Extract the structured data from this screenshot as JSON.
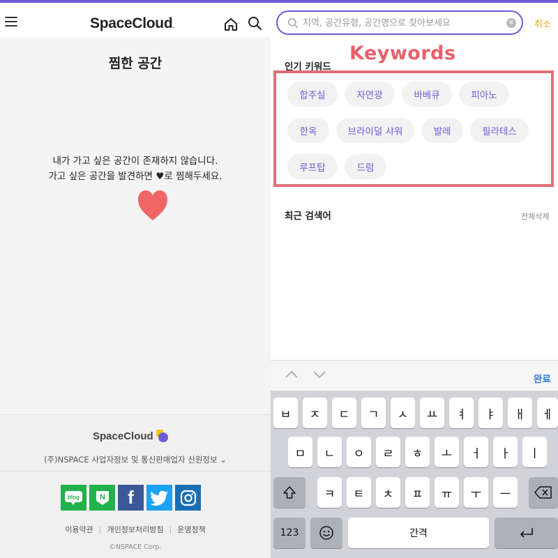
{
  "left": {
    "brand": "SpaceCloud",
    "title": "찜한 공간",
    "empty_line1": "내가 가고 싶은 공간이 존재하지 않습니다.",
    "empty_line2_before": "가고 싶은 공간을 발견하면 ",
    "empty_line2_heart": "♥",
    "empty_line2_after": "로 찜해두세요.",
    "footer": {
      "brand": "SpaceCloud",
      "company": "(주)NSPACE 사업자정보 및 통신판매업자 신원정보",
      "social": [
        {
          "name": "blog",
          "label": "blog",
          "color": "#21b24b"
        },
        {
          "name": "naver-post",
          "label": "N",
          "color": "#21b24b"
        },
        {
          "name": "facebook",
          "label": "f",
          "color": "#3b5998"
        },
        {
          "name": "twitter",
          "label": "",
          "color": "#1da1f2"
        },
        {
          "name": "instagram",
          "label": "",
          "color": "#1a6fb5"
        }
      ],
      "links": [
        "이용약관",
        "개인정보처리방침",
        "운영정책"
      ],
      "copyright": "©NSPACE Corp."
    }
  },
  "right": {
    "search": {
      "placeholder": "지역, 공간유형, 공간명으로 찾아보세요",
      "value": ""
    },
    "cancel": "취소",
    "annotation": "Keywords",
    "popular_title": "인기 키워드",
    "keywords": [
      "합주실",
      "자연광",
      "바베큐",
      "피아노",
      "한옥",
      "브라이덜 샤워",
      "발레",
      "필라테스",
      "루프탑",
      "드럼"
    ],
    "recent_title": "최근 검색어",
    "clear_all": "전체삭제",
    "keyboard": {
      "done": "완료",
      "row1": [
        "ㅂ",
        "ㅈ",
        "ㄷ",
        "ㄱ",
        "ㅅ",
        "ㅛ",
        "ㅕ",
        "ㅑ",
        "ㅐ",
        "ㅔ"
      ],
      "row2": [
        "ㅁ",
        "ㄴ",
        "ㅇ",
        "ㄹ",
        "ㅎ",
        "ㅗ",
        "ㅓ",
        "ㅏ",
        "ㅣ"
      ],
      "row3": [
        "ㅋ",
        "ㅌ",
        "ㅊ",
        "ㅍ",
        "ㅠ",
        "ㅜ",
        "ㅡ"
      ],
      "numbers": "123",
      "space": "간격"
    }
  },
  "colors": {
    "accent": "#6b5bd6",
    "heart": "#ee6666",
    "annotation": "#e26f77",
    "cancel": "#e0a800",
    "done": "#2e7ad6"
  }
}
